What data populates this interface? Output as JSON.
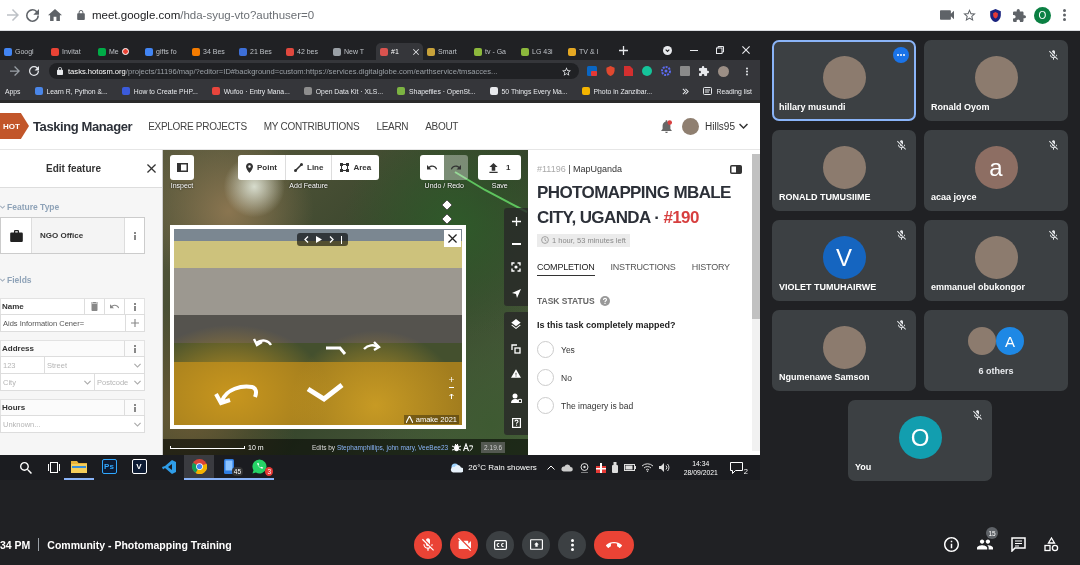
{
  "browser": {
    "url_host": "meet.google.com",
    "url_path": "/hda-syug-vto?authuser=0",
    "profile_initial": "O"
  },
  "shared_window": {
    "tabs": [
      {
        "label": "Googl",
        "color": "#4285f4",
        "selected": false,
        "recording": false
      },
      {
        "label": "Invitat",
        "color": "#ea4335",
        "selected": false,
        "recording": false
      },
      {
        "label": "Me",
        "color": "#00ac47",
        "selected": false,
        "recording": true
      },
      {
        "label": "gifts fo",
        "color": "#4285f4",
        "selected": false,
        "recording": false
      },
      {
        "label": "34 Bes",
        "color": "#f57c00",
        "selected": false,
        "recording": false
      },
      {
        "label": "21 Bes",
        "color": "#3d6fd8",
        "selected": false,
        "recording": false
      },
      {
        "label": "42 bes",
        "color": "#e0483e",
        "selected": false,
        "recording": false
      },
      {
        "label": "New T",
        "color": "#9aa0a6",
        "selected": false,
        "recording": false
      },
      {
        "label": "#1",
        "color": "#d9534f",
        "selected": true,
        "recording": false
      },
      {
        "label": "Smart",
        "color": "#c8a23a",
        "selected": false,
        "recording": false
      },
      {
        "label": "tv - Ga",
        "color": "#8cb83c",
        "selected": false,
        "recording": false
      },
      {
        "label": "LG 43i",
        "color": "#8cb83c",
        "selected": false,
        "recording": false
      },
      {
        "label": "TV & I",
        "color": "#e5a823",
        "selected": false,
        "recording": false
      }
    ],
    "url_host": "tasks.hotosm.org",
    "url_path": "/projects/11196/map/?editor=ID#background=custom:https://services.digitalglobe.com/earthservice/tmsacces...",
    "apps_label": "Apps",
    "bookmarks": [
      {
        "label": "Learn R, Python &...",
        "color": "#4a86e8"
      },
      {
        "label": "How to Create PHP...",
        "color": "#3b5bdb"
      },
      {
        "label": "Wufoo · Entry Mana...",
        "color": "#e8453c"
      },
      {
        "label": "Open Data Kit · XLS...",
        "color": "#8d8d8d"
      },
      {
        "label": "Shapefiles · OpenSt...",
        "color": "#7cb342"
      },
      {
        "label": "50 Things Every Ma...",
        "color": "#e8eaed"
      },
      {
        "label": "Photo in Zanzibar...",
        "color": "#f4b400"
      }
    ],
    "reading_list": "Reading list"
  },
  "tasking_manager": {
    "logo_text": "HOT",
    "brand": "Tasking Manager",
    "nav": [
      {
        "label": "EXPLORE PROJECTS"
      },
      {
        "label": "MY CONTRIBUTIONS"
      },
      {
        "label": "LEARN"
      },
      {
        "label": "ABOUT"
      }
    ],
    "username": "Hills95",
    "notifications_unread": true,
    "editor": {
      "title": "Edit feature",
      "feature_type_heading": "Feature Type",
      "feature_type": "NGO Office",
      "fields_heading": "Fields",
      "fields": [
        {
          "kind": "text",
          "label": "Name",
          "modified": true,
          "value": "Aids Information Cener="
        },
        {
          "kind": "address",
          "label": "Address",
          "modified": false,
          "rows": [
            [
              {
                "placeholder": "123",
                "dropdown": false
              },
              {
                "placeholder": "Street",
                "dropdown": true
              }
            ],
            [
              {
                "placeholder": "City",
                "dropdown": true
              },
              {
                "placeholder": "Postcode",
                "dropdown": true
              }
            ]
          ]
        },
        {
          "kind": "combo",
          "label": "Hours",
          "modified": false,
          "placeholder": "Unknown..."
        }
      ]
    },
    "map": {
      "inspect_label": "Inspect",
      "modes": [
        {
          "kind": "point",
          "label": "Point"
        },
        {
          "kind": "line",
          "label": "Line"
        },
        {
          "kind": "area",
          "label": "Area"
        }
      ],
      "add_label": "Add Feature",
      "history": [
        {
          "kind": "undo",
          "disabled": false
        },
        {
          "kind": "redo",
          "disabled": true
        }
      ],
      "history_label": "Undo / Redo",
      "save_count": "1",
      "save_label": "Save",
      "photo": {
        "attribution": "amake 2021"
      },
      "scale": "10 m",
      "edits_prefix": "Edits by",
      "editors": "Stephamphillips, john mary, VeeBee23",
      "version": "2.19.6"
    },
    "task": {
      "project_id": "#11196",
      "organisation": "| MapUganda",
      "title": "PHOTOMAPPING MBALE CITY, UGANDA ·",
      "task_number": "#190",
      "time_left": "1 hour, 53 minutes left",
      "tabs": [
        {
          "label": "COMPLETION",
          "selected": true
        },
        {
          "label": "INSTRUCTIONS",
          "selected": false
        },
        {
          "label": "HISTORY",
          "selected": false
        }
      ],
      "status_heading": "TASK STATUS",
      "question": "Is this task completely mapped?",
      "options": [
        {
          "label": "Yes",
          "selected": false
        },
        {
          "label": "No",
          "selected": false
        },
        {
          "label": "The imagery is bad",
          "selected": false
        }
      ]
    }
  },
  "taskbar": {
    "apps": [
      {
        "kind": "explorer",
        "running": true,
        "selected": false
      },
      {
        "kind": "letter",
        "label": "Ps",
        "color": "#31a8ff",
        "running": false,
        "selected": false
      },
      {
        "kind": "letter",
        "label": "V",
        "color": "#ffffff",
        "running": false,
        "selected": false
      },
      {
        "kind": "code",
        "running": false,
        "selected": false
      },
      {
        "kind": "browser",
        "running": true,
        "selected": true
      },
      {
        "kind": "phone",
        "badge": "45",
        "running": true,
        "selected": false
      },
      {
        "kind": "chat",
        "badge": "3",
        "running": true,
        "selected": false
      }
    ],
    "weather": "26°C Rain showers",
    "time": "14:34",
    "date": "28/09/2021",
    "notifications": "2"
  },
  "participants": [
    {
      "kind": "person",
      "name": "hillary musundi",
      "avatar": {
        "kind": "photo"
      },
      "muted": false,
      "hovered": true
    },
    {
      "kind": "person",
      "name": "Ronald Oyom",
      "avatar": {
        "kind": "photo"
      },
      "muted": true,
      "hovered": false
    },
    {
      "kind": "person",
      "name": "RONALD TUMUSIIME",
      "avatar": {
        "kind": "photo"
      },
      "muted": true,
      "hovered": false
    },
    {
      "kind": "person",
      "name": "acaa joyce",
      "avatar": {
        "kind": "letter",
        "initial": "a",
        "color": "#8d6e63"
      },
      "muted": true,
      "hovered": false
    },
    {
      "kind": "person",
      "name": "VIOLET TUMUHAIRWE",
      "avatar": {
        "kind": "letter",
        "initial": "V",
        "color": "#1565c0"
      },
      "muted": true,
      "hovered": false
    },
    {
      "kind": "person",
      "name": "emmanuel obukongor",
      "avatar": {
        "kind": "photo"
      },
      "muted": true,
      "hovered": false
    },
    {
      "kind": "person",
      "name": "Ngumenawe Samson",
      "avatar": {
        "kind": "photo"
      },
      "muted": true,
      "hovered": false
    },
    {
      "kind": "others",
      "name": "6 others",
      "avatars": [
        {
          "kind": "photo"
        },
        {
          "kind": "letter",
          "initial": "A",
          "color": "#1e88e5"
        }
      ],
      "hovered": false
    },
    {
      "kind": "person",
      "name": "You",
      "avatar": {
        "kind": "letter",
        "initial": "O",
        "color": "#129eaf"
      },
      "muted": true,
      "hovered": false
    }
  ],
  "meeting": {
    "time": "34 PM",
    "title": "Community - Photomapping Training",
    "controls": [
      {
        "kind": "mic",
        "on": false
      },
      {
        "kind": "camera",
        "on": false
      },
      {
        "kind": "captions",
        "on": false
      },
      {
        "kind": "present"
      },
      {
        "kind": "more"
      },
      {
        "kind": "leave"
      }
    ],
    "people_count": "15"
  }
}
